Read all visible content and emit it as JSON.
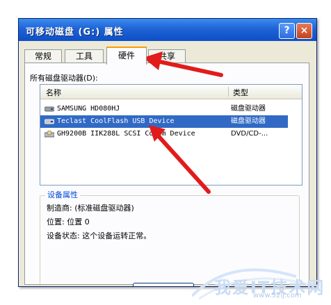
{
  "window": {
    "title": "可移动磁盘 (G:) 属性",
    "help_label": "?",
    "close_label": "×"
  },
  "tabs": [
    {
      "label": "常规"
    },
    {
      "label": "工具"
    },
    {
      "label": "硬件",
      "active": true
    },
    {
      "label": "共享"
    }
  ],
  "devices": {
    "label": "所有磁盘驱动器(D):",
    "columns": {
      "name": "名称",
      "type": "类型"
    },
    "rows": [
      {
        "name": "SAMSUNG HD080HJ",
        "type": "磁盘驱动器",
        "icon": "disk-drive-icon"
      },
      {
        "name": "Teclast CoolFlash USB Device",
        "type": "磁盘驱动器",
        "icon": "disk-drive-icon",
        "selected": true
      },
      {
        "name": "GH9200B IIK288L SCSI CdRom Device",
        "type": "DVD/CD-...",
        "icon": "cdrom-icon"
      }
    ]
  },
  "properties": {
    "legend": "设备属性",
    "manufacturer": "制造商: (标准磁盘驱动器)",
    "location": "位置: 位置 0",
    "status": "设备状态: 这个设备运转正常。"
  },
  "watermark": {
    "text": "我爱IT技术网",
    "url": "www.52ij.com"
  },
  "colors": {
    "titlebar": "#0d4fc6",
    "selection": "#316ac5",
    "arrow": "#e21b1b",
    "active_tab_accent": "#ff9c00"
  }
}
